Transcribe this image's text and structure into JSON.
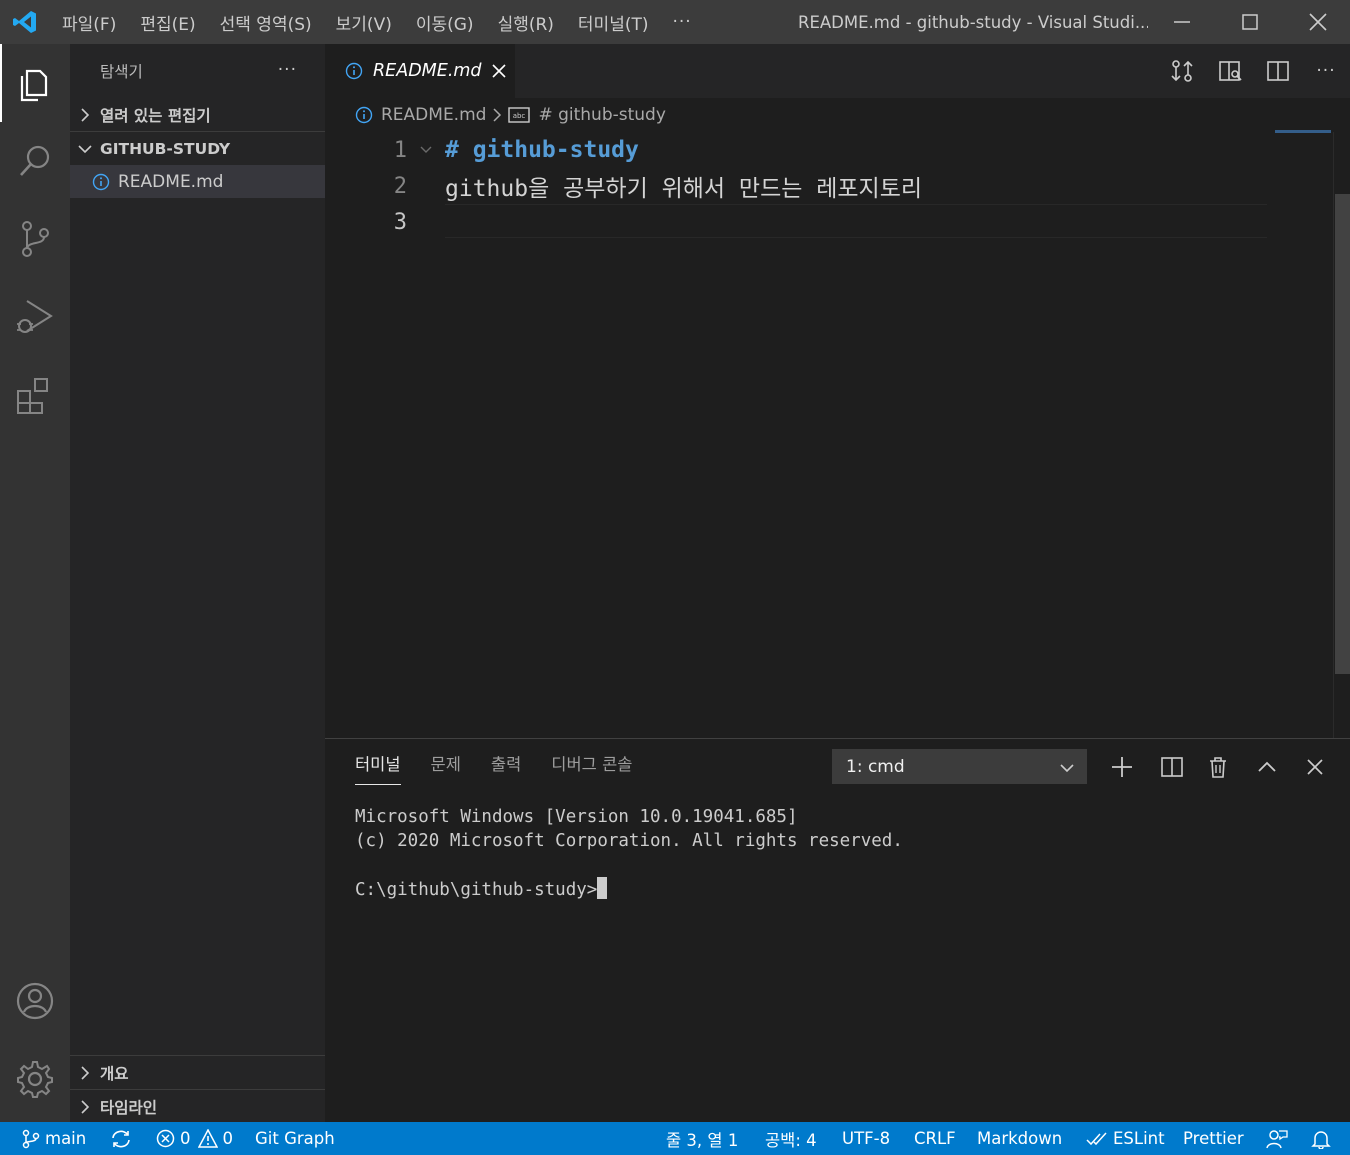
{
  "window": {
    "menu": [
      "파일(F)",
      "편집(E)",
      "선택 영역(S)",
      "보기(V)",
      "이동(G)",
      "실행(R)",
      "터미널(T)"
    ],
    "menu_more": "···",
    "title": "README.md - github-study - Visual Studi..."
  },
  "sidebar": {
    "title": "탐색기",
    "more": "···",
    "open_editors": "열려 있는 편집기",
    "folder": "GITHUB-STUDY",
    "files": [
      "README.md"
    ],
    "outline": "개요",
    "timeline": "타임라인"
  },
  "editor": {
    "tab_label": "README.md",
    "breadcrumb_file": "README.md",
    "breadcrumb_symbol": "# github-study",
    "lines": [
      {
        "num": "1",
        "text": "# github-study"
      },
      {
        "num": "2",
        "text": "github을 공부하기 위해서 만드는 레포지토리"
      },
      {
        "num": "3",
        "text": ""
      }
    ]
  },
  "panel": {
    "tabs": [
      "터미널",
      "문제",
      "출력",
      "디버그 콘솔"
    ],
    "terminal_select": "1: cmd",
    "terminal_lines": [
      "Microsoft Windows [Version 10.0.19041.685]",
      "(c) 2020 Microsoft Corporation. All rights reserved.",
      "",
      "C:\\github\\github-study>"
    ]
  },
  "statusbar": {
    "branch": "main",
    "errors": "0",
    "warnings": "0",
    "git_graph": "Git Graph",
    "position": "줄 3, 열 1",
    "spaces": "공백: 4",
    "encoding": "UTF-8",
    "eol": "CRLF",
    "language": "Markdown",
    "eslint": "ESLint",
    "prettier": "Prettier"
  },
  "colors": {
    "accent": "#007acc",
    "heading": "#569cd6",
    "logo": "#23a9f2"
  },
  "icons": [
    "vscode-logo-icon",
    "explorer-icon",
    "search-icon",
    "source-control-icon",
    "run-debug-icon",
    "extensions-icon",
    "account-icon",
    "settings-gear-icon",
    "info-icon",
    "close-icon",
    "split-editor-icon",
    "open-changes-icon",
    "open-preview-icon",
    "trash-icon",
    "plus-icon",
    "bell-icon",
    "feedback-icon",
    "sync-icon",
    "error-icon",
    "warning-icon",
    "branch-icon",
    "check-all-icon"
  ]
}
